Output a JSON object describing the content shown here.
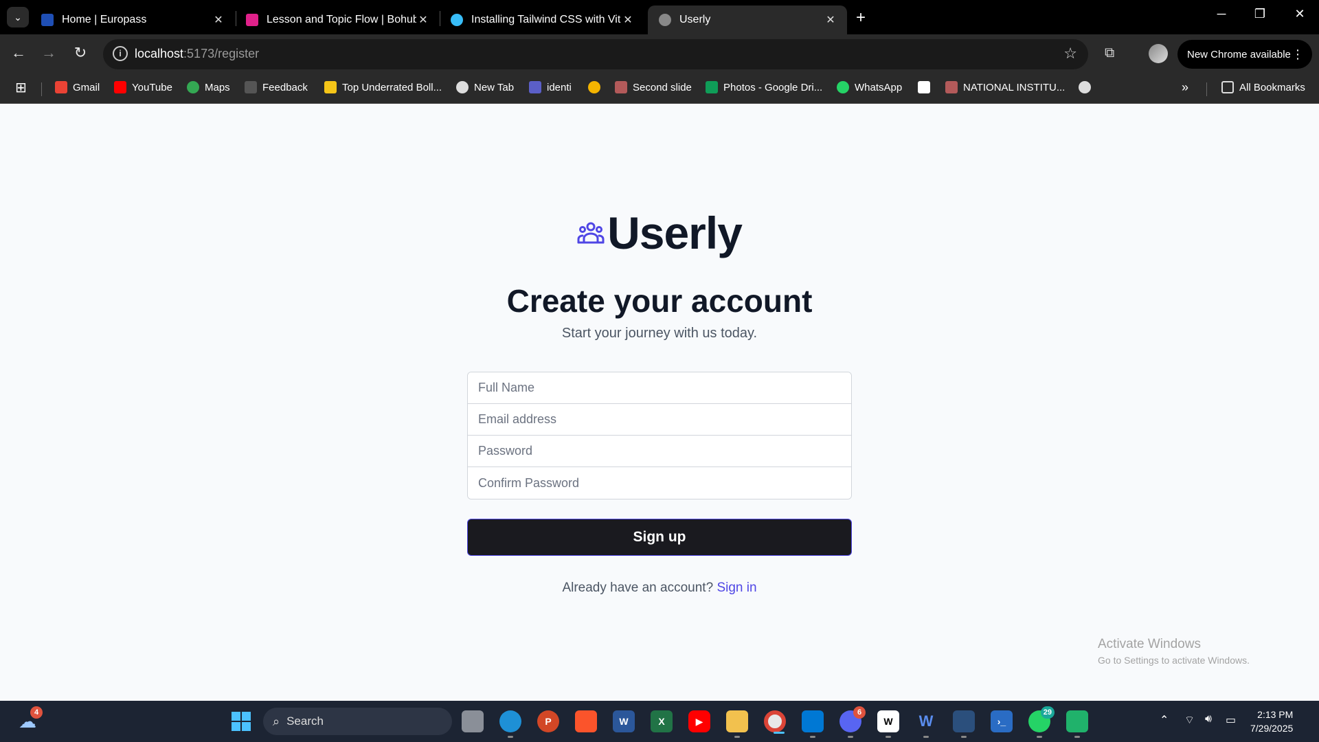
{
  "browser": {
    "tabs": [
      {
        "title": "Home | Europass",
        "color": "#1f4fb5"
      },
      {
        "title": "Lesson and Topic Flow | Bohubrihi",
        "color": "#e0218a"
      },
      {
        "title": "Installing Tailwind CSS with Vite",
        "color": "#38bdf8"
      },
      {
        "title": "Userly",
        "color": "#888888"
      }
    ],
    "url_host": "localhost",
    "url_path": ":5173/register",
    "update_label": "New Chrome available",
    "bookmarks": [
      {
        "label": "Gmail",
        "color": "#ea4335"
      },
      {
        "label": "YouTube",
        "color": "#ff0000"
      },
      {
        "label": "Maps",
        "color": "#34a853"
      },
      {
        "label": "Feedback",
        "color": "#555555"
      },
      {
        "label": "Top Underrated Boll...",
        "color": "#f5c518"
      },
      {
        "label": "New Tab",
        "color": "#dddddd"
      },
      {
        "label": "identi",
        "color": "#5b5fc7"
      },
      {
        "label": "",
        "color": "#f4b400"
      },
      {
        "label": "Second slide",
        "color": "#b35a5a"
      },
      {
        "label": "Photos - Google Dri...",
        "color": "#0f9d58"
      },
      {
        "label": "WhatsApp",
        "color": "#25d366"
      },
      {
        "label": "",
        "color": "#ffffff"
      },
      {
        "label": "NATIONAL INSTITU...",
        "color": "#b35a5a"
      },
      {
        "label": "",
        "color": "#dddddd"
      }
    ],
    "all_bookmarks": "All Bookmarks"
  },
  "page": {
    "brand": "Userly",
    "accent": "#4f46e5",
    "heading": "Create your account",
    "subheading": "Start your journey with us today.",
    "fields": {
      "full_name": "Full Name",
      "email": "Email address",
      "password": "Password",
      "confirm": "Confirm Password"
    },
    "signup_label": "Sign up",
    "signin_prompt": "Already have an account?",
    "signin_link": "Sign in"
  },
  "watermark": {
    "title": "Activate Windows",
    "subtitle": "Go to Settings to activate Windows."
  },
  "taskbar": {
    "search_label": "Search",
    "weather_badge": "4",
    "discord_badge": "6",
    "whatsapp_badge": "29",
    "time": "2:13 PM",
    "date": "7/29/2025"
  }
}
